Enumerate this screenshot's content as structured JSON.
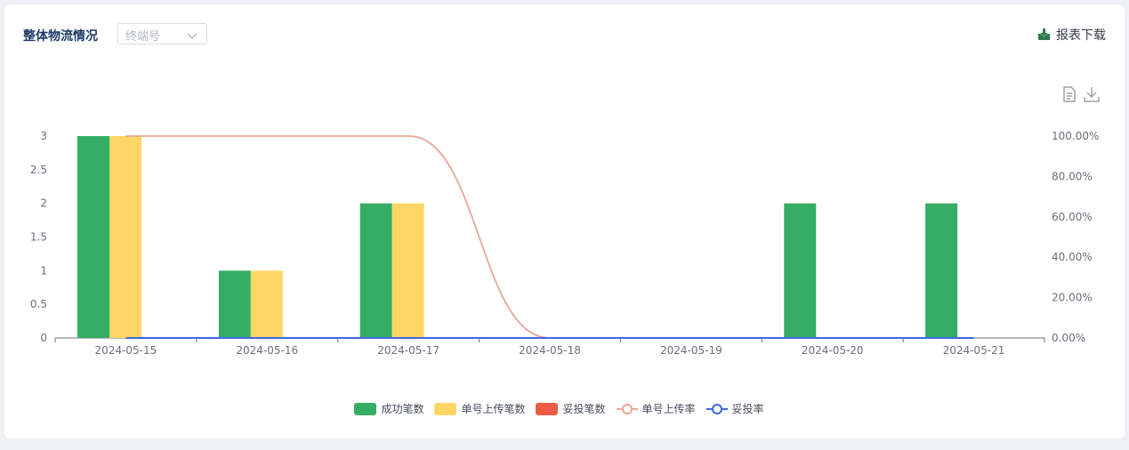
{
  "header": {
    "title": "整体物流情况",
    "select_placeholder": "终端号",
    "download_label": "报表下载"
  },
  "toolbar": {
    "data_view_icon": "document-icon",
    "save_image_icon": "download-icon"
  },
  "colors": {
    "success": "#35ad63",
    "upload": "#ffd666",
    "delivered": "#ee5a45",
    "upload_rate": "#eaa696",
    "delivered_rate": "#3f68e0",
    "accent": "#2f7a4a"
  },
  "chart_data": {
    "type": "bar",
    "categories": [
      "2024-05-15",
      "2024-05-16",
      "2024-05-17",
      "2024-05-18",
      "2024-05-19",
      "2024-05-20",
      "2024-05-21"
    ],
    "series": [
      {
        "name": "成功笔数",
        "type": "bar",
        "axis": "left",
        "values": [
          3,
          1,
          2,
          0,
          0,
          2,
          2
        ]
      },
      {
        "name": "单号上传笔数",
        "type": "bar",
        "axis": "left",
        "values": [
          3,
          1,
          2,
          0,
          0,
          0,
          0
        ]
      },
      {
        "name": "妥投笔数",
        "type": "bar",
        "axis": "left",
        "values": [
          0,
          0,
          0,
          0,
          0,
          0,
          0
        ]
      },
      {
        "name": "单号上传率",
        "type": "line",
        "axis": "right",
        "smooth": true,
        "values": [
          100,
          100,
          100,
          0,
          0,
          0,
          0
        ]
      },
      {
        "name": "妥投率",
        "type": "line",
        "axis": "right",
        "values": [
          0,
          0,
          0,
          0,
          0,
          0,
          0
        ]
      }
    ],
    "yticks_left": [
      "0",
      "0.5",
      "1",
      "1.5",
      "2",
      "2.5",
      "3"
    ],
    "yticks_right": [
      "0.00%",
      "20.00%",
      "40.00%",
      "60.00%",
      "80.00%",
      "100.00%"
    ],
    "ylim_left": [
      0,
      3
    ],
    "ylim_right": [
      0,
      100
    ],
    "legend_position": "bottom-center",
    "grid": false
  }
}
